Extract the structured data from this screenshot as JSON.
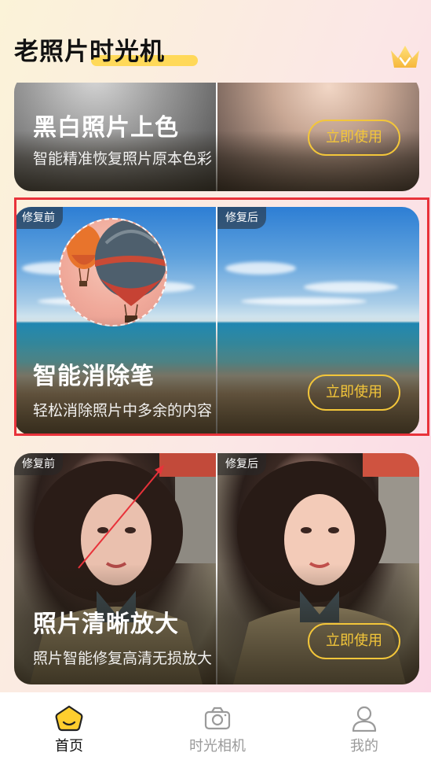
{
  "header": {
    "title": "老照片时光机",
    "crown_icon": "crown-icon"
  },
  "cards": [
    {
      "title": "黑白照片上色",
      "subtitle": "智能精准恢复照片原本色彩",
      "button": "立即使用"
    },
    {
      "before_tag": "修复前",
      "after_tag": "修复后",
      "title": "智能消除笔",
      "subtitle": "轻松消除照片中多余的内容",
      "button": "立即使用"
    },
    {
      "before_tag": "修复前",
      "after_tag": "修复后",
      "title": "照片清晰放大",
      "subtitle": "照片智能修复高清无损放大",
      "button": "立即使用"
    }
  ],
  "tabbar": {
    "items": [
      {
        "label": "首页",
        "icon": "home-icon",
        "active": true
      },
      {
        "label": "时光相机",
        "icon": "camera-icon",
        "active": false
      },
      {
        "label": "我的",
        "icon": "profile-icon",
        "active": false
      }
    ]
  },
  "colors": {
    "accent": "#f3c63a",
    "highlight": "#e8323a",
    "active_tab": "#111111",
    "inactive_tab": "#9a9a9a"
  }
}
